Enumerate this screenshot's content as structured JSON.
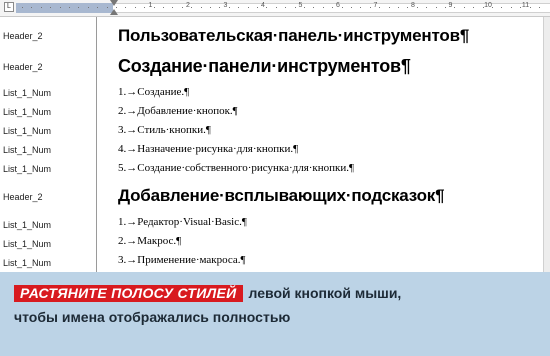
{
  "ruler": {
    "tab_selector": "L",
    "numbers": [
      "1",
      "2",
      "3",
      "4",
      "5",
      "6",
      "7",
      "8",
      "9",
      "10",
      "11"
    ]
  },
  "styles": [
    "Header_2",
    "Header_2",
    "List_1_Num",
    "List_1_Num",
    "List_1_Num",
    "List_1_Num",
    "List_1_Num",
    "Header_2",
    "List_1_Num",
    "List_1_Num",
    "List_1_Num"
  ],
  "document": {
    "heading_1": "Пользовательская·панель·инструментов¶",
    "heading_2": "Создание·панели·инструментов¶",
    "list_1": [
      "1.→Создание.¶",
      "2.→Добавление·кнопок.¶",
      "3.→Стиль·кнопки.¶",
      "4.→Назначение·рисунка·для·кнопки.¶",
      "5.→Создание·собственного·рисунка·для·кнопки.¶"
    ],
    "heading_3": "Добавление·всплывающих·подсказок¶",
    "list_2": [
      "1.→Редактор·Visual·Basic.¶",
      "2.→Макрос.¶",
      "3.→Применение·макроса.¶"
    ]
  },
  "caption": {
    "highlight": "РАСТЯНИТЕ ПОЛОСУ СТИЛЕЙ",
    "text_line1": "левой кнопкой мыши,",
    "text_line2": "чтобы имена отображались полностью"
  },
  "colors": {
    "caption_bg": "#bcd3e6",
    "highlight_bg": "#d81a1f"
  }
}
